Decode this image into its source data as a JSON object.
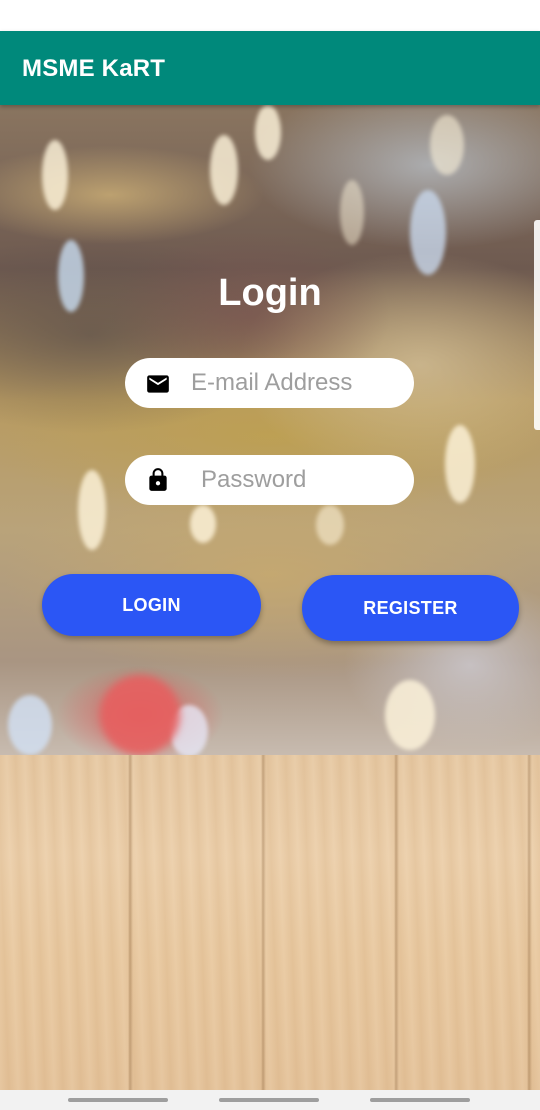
{
  "app_bar": {
    "title": "MSME KaRT",
    "color": "#00897b"
  },
  "login_form": {
    "heading": "Login",
    "email": {
      "placeholder": "E-mail Address",
      "icon": "mail-icon"
    },
    "password": {
      "placeholder": "Password",
      "icon": "lock-icon"
    },
    "login_label": "LOGIN",
    "register_label": "REGISTER",
    "button_color": "#2b56f5"
  },
  "navigation_bar": {
    "buttons": [
      "recent-apps",
      "home",
      "back"
    ]
  }
}
